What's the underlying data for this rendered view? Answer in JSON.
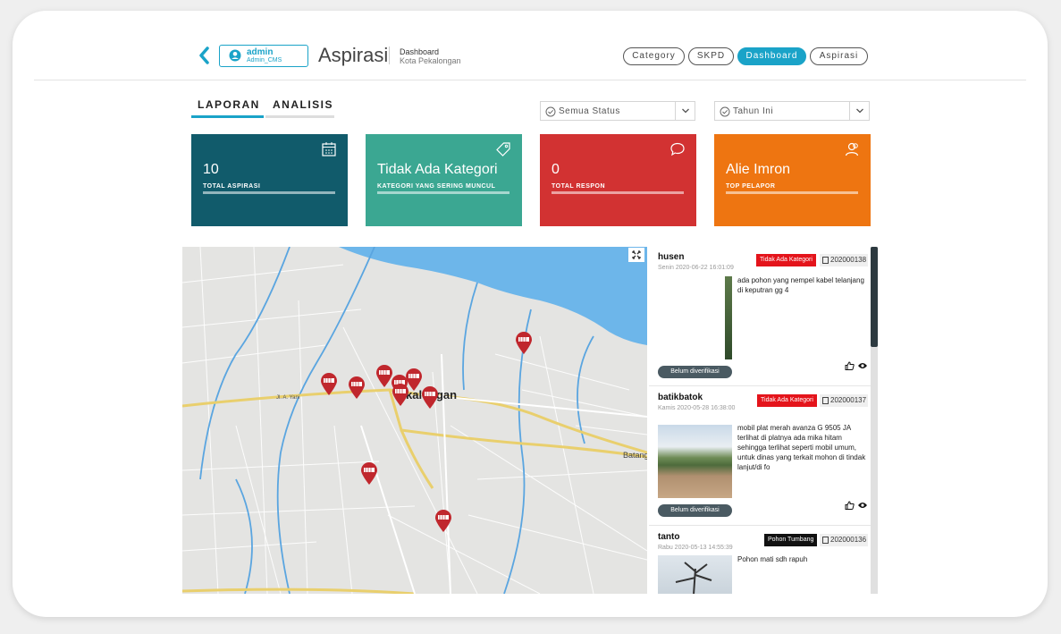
{
  "header": {
    "user_name": "admin",
    "user_role": "Admin_CMS",
    "app_title": "Aspirasi",
    "breadcrumb_title": "Dashboard",
    "breadcrumb_sub": "Kota Pekalongan",
    "nav": [
      "Category",
      "SKPD",
      "Dashboard",
      "Aspirasi"
    ],
    "nav_active": "Dashboard"
  },
  "tabs": [
    {
      "label": "LAPORAN",
      "active": true
    },
    {
      "label": "ANALISIS",
      "active": false
    }
  ],
  "filters": {
    "status": "Semua Status",
    "year": "Tahun Ini"
  },
  "cards": [
    {
      "value": "10",
      "label": "TOTAL ASPIRASI",
      "color": "#115b6b",
      "icon": "calendar-icon"
    },
    {
      "value": "Tidak Ada Kategori",
      "label": "KATEGORI YANG SERING MUNCUL",
      "color": "#3ba792",
      "icon": "tag-icon"
    },
    {
      "value": "0",
      "label": "TOTAL RESPON",
      "color": "#d23232",
      "icon": "chat-bubble-icon"
    },
    {
      "value": "Alie Imron",
      "label": "TOP PELAPOR",
      "color": "#ee7511",
      "icon": "users-icon"
    }
  ],
  "map": {
    "place_label": "kalongan",
    "place_label_2": "Batang",
    "road_label": "Jl. A. Yani"
  },
  "posts": [
    {
      "name": "husen",
      "date": "Senin 2020-06-22 16:01:09",
      "category": "Tidak Ada Kategori",
      "category_color": "#e4141b",
      "id": "202000138",
      "text": "ada pohon yang nempel kabel telanjang di keputran gg 4",
      "status": "Belum diverifikasi"
    },
    {
      "name": "batikbatok",
      "date": "Kamis 2020-05-28 16:38:00",
      "category": "Tidak Ada Kategori",
      "category_color": "#e4141b",
      "id": "202000137",
      "text": "mobil plat merah avanza G 9505 JA terlihat di platnya ada mika hitam sehingga terlihat seperti mobil umum, untuk dinas yang terkait mohon di tindak lanjut/di fo",
      "status": "Belum diverifikasi"
    },
    {
      "name": "tanto",
      "date": "Rabu 2020-05-13 14:55:39",
      "category": "Pohon Tumbang",
      "category_color": "#111111",
      "id": "202000136",
      "text": "Pohon mati sdh rapuh",
      "status": ""
    }
  ]
}
